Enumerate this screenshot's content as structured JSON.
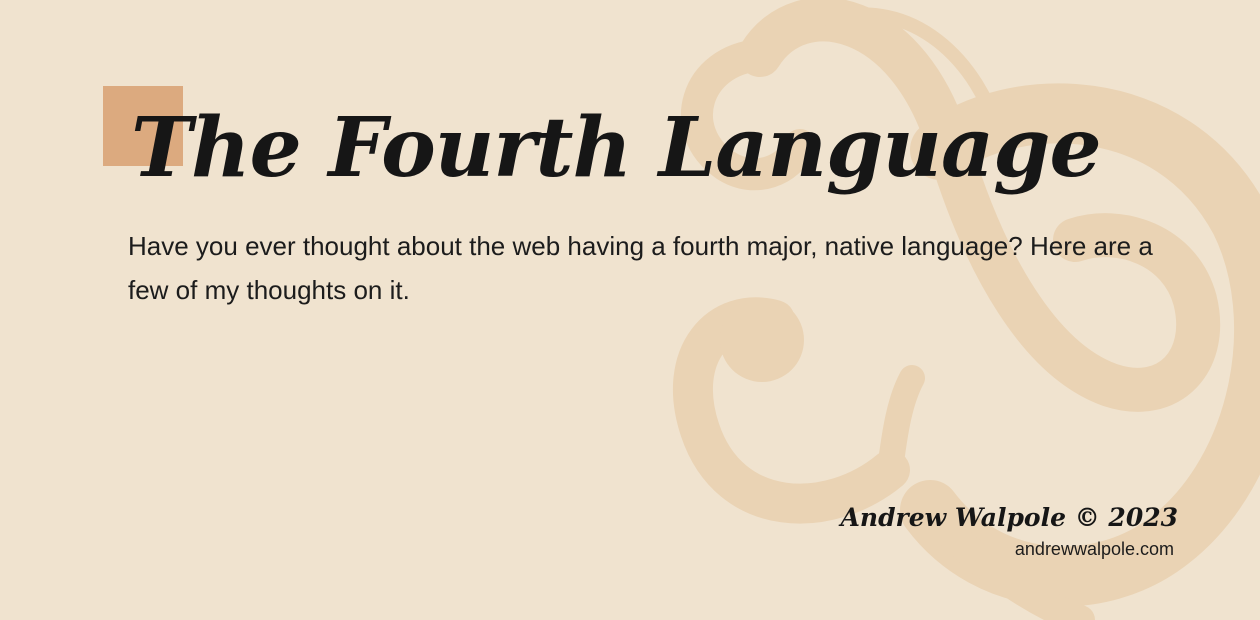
{
  "title": "The Fourth Language",
  "description": "Have you ever thought about the web having a fourth major, native language? Here are a few of my thoughts on it.",
  "byline": {
    "author": "Andrew Walpole © 2023",
    "website": "andrewwalpole.com"
  },
  "colors": {
    "background": "#f0e3cf",
    "ampersand": "#ead3b4",
    "accent": "#dcaa7f",
    "text": "#161616"
  },
  "decoration": {
    "background_glyph": "ampersand-icon"
  }
}
